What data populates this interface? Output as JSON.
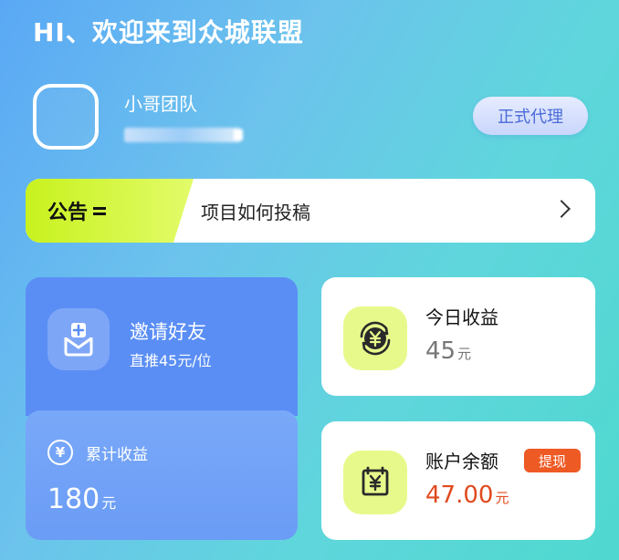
{
  "header": {
    "greeting": "HI、欢迎来到众城联盟"
  },
  "profile": {
    "team_name": "小哥团队",
    "role_badge": "正式代理"
  },
  "notice": {
    "tag": "公告",
    "text": "项目如何投稿"
  },
  "invite": {
    "title": "邀请好友",
    "subtitle": "直推45元/位"
  },
  "total_income": {
    "yen": "¥",
    "label": "累计收益",
    "value": "180",
    "unit": "元"
  },
  "today_income": {
    "title": "今日收益",
    "value": "45",
    "unit": "元"
  },
  "balance": {
    "title": "账户余额",
    "withdraw_label": "提现",
    "value": "47.00",
    "unit": "元"
  },
  "colors": {
    "accent_blue": "#5a8ef5",
    "accent_lime": "#c8f21e",
    "balance_red": "#e04a1e",
    "withdraw_orange": "#ee5a24"
  },
  "icons": {
    "invite": "mail-plus-icon",
    "today": "yen-refresh-icon",
    "balance": "yen-wallet-icon",
    "notice": "double-arrow-icon",
    "chevron": "chevron-right-icon"
  }
}
